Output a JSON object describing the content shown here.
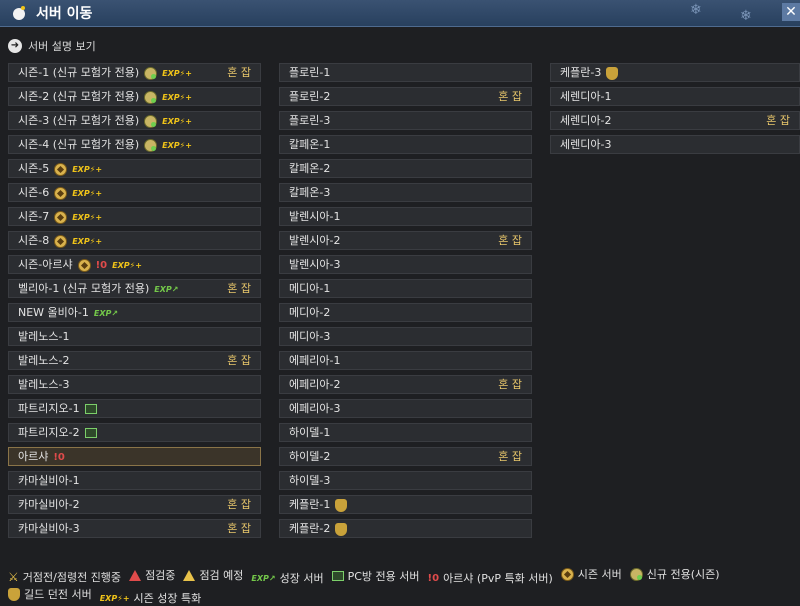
{
  "window": {
    "title": "서버 이동",
    "close_label": "✕"
  },
  "description_link": "서버 설명 보기",
  "columns": [
    [
      {
        "name": "시즌-1 (신규 모험가 전용)",
        "icons": [
          "newseason",
          "expup"
        ],
        "crowd": "혼 잡"
      },
      {
        "name": "시즌-2 (신규 모험가 전용)",
        "icons": [
          "newseason",
          "expup"
        ],
        "crowd": ""
      },
      {
        "name": "시즌-3 (신규 모험가 전용)",
        "icons": [
          "newseason",
          "expup"
        ],
        "crowd": ""
      },
      {
        "name": "시즌-4 (신규 모험가 전용)",
        "icons": [
          "newseason",
          "expup"
        ],
        "crowd": ""
      },
      {
        "name": "시즌-5",
        "icons": [
          "season",
          "expup"
        ],
        "crowd": ""
      },
      {
        "name": "시즌-6",
        "icons": [
          "season",
          "expup"
        ],
        "crowd": ""
      },
      {
        "name": "시즌-7",
        "icons": [
          "season",
          "expup"
        ],
        "crowd": ""
      },
      {
        "name": "시즌-8",
        "icons": [
          "season",
          "expup"
        ],
        "crowd": ""
      },
      {
        "name": "시즌-아르샤",
        "icons": [
          "season",
          "pvp",
          "expup"
        ],
        "crowd": ""
      },
      {
        "name": "벨리아-1 (신규 모험가 전용)",
        "icons": [
          "growth"
        ],
        "crowd": "혼 잡"
      },
      {
        "name": "NEW 올비아-1",
        "icons": [
          "growth"
        ],
        "crowd": ""
      },
      {
        "name": "발레노스-1",
        "icons": [],
        "crowd": ""
      },
      {
        "name": "발레노스-2",
        "icons": [],
        "crowd": "혼 잡"
      },
      {
        "name": "발레노스-3",
        "icons": [],
        "crowd": ""
      },
      {
        "name": "파트리지오-1",
        "icons": [
          "pc"
        ],
        "crowd": ""
      },
      {
        "name": "파트리지오-2",
        "icons": [
          "pc"
        ],
        "crowd": ""
      },
      {
        "name": "아르샤",
        "icons": [
          "pvp"
        ],
        "crowd": "",
        "selected": true
      },
      {
        "name": "카마실비아-1",
        "icons": [],
        "crowd": ""
      },
      {
        "name": "카마실비아-2",
        "icons": [],
        "crowd": "혼 잡"
      },
      {
        "name": "카마실비아-3",
        "icons": [],
        "crowd": "혼 잡"
      }
    ],
    [
      {
        "name": "플로린-1",
        "icons": [],
        "crowd": ""
      },
      {
        "name": "플로린-2",
        "icons": [],
        "crowd": "혼 잡"
      },
      {
        "name": "플로린-3",
        "icons": [],
        "crowd": ""
      },
      {
        "name": "칼페온-1",
        "icons": [],
        "crowd": ""
      },
      {
        "name": "칼페온-2",
        "icons": [],
        "crowd": ""
      },
      {
        "name": "칼페온-3",
        "icons": [],
        "crowd": ""
      },
      {
        "name": "발렌시아-1",
        "icons": [],
        "crowd": ""
      },
      {
        "name": "발렌시아-2",
        "icons": [],
        "crowd": "혼 잡"
      },
      {
        "name": "발렌시아-3",
        "icons": [],
        "crowd": ""
      },
      {
        "name": "메디아-1",
        "icons": [],
        "crowd": ""
      },
      {
        "name": "메디아-2",
        "icons": [],
        "crowd": ""
      },
      {
        "name": "메디아-3",
        "icons": [],
        "crowd": ""
      },
      {
        "name": "에페리아-1",
        "icons": [],
        "crowd": ""
      },
      {
        "name": "에페리아-2",
        "icons": [],
        "crowd": "혼 잡"
      },
      {
        "name": "에페리아-3",
        "icons": [],
        "crowd": ""
      },
      {
        "name": "하이델-1",
        "icons": [],
        "crowd": ""
      },
      {
        "name": "하이델-2",
        "icons": [],
        "crowd": "혼 잡"
      },
      {
        "name": "하이델-3",
        "icons": [],
        "crowd": ""
      },
      {
        "name": "케플란-1",
        "icons": [
          "guild"
        ],
        "crowd": ""
      },
      {
        "name": "케플란-2",
        "icons": [
          "guild"
        ],
        "crowd": ""
      }
    ],
    [
      {
        "name": "케플란-3",
        "icons": [
          "guild"
        ],
        "crowd": ""
      },
      {
        "name": "세렌디아-1",
        "icons": [],
        "crowd": ""
      },
      {
        "name": "세렌디아-2",
        "icons": [],
        "crowd": "혼 잡"
      },
      {
        "name": "세렌디아-3",
        "icons": [],
        "crowd": ""
      }
    ]
  ],
  "legend_line1": [
    {
      "icon": "swords",
      "label": "거점전/점령전 진행중"
    },
    {
      "icon": "maintenance",
      "label": "점검중"
    },
    {
      "icon": "scheduled",
      "label": "점검 예정"
    },
    {
      "icon": "growth",
      "label": "성장 서버"
    },
    {
      "icon": "pc",
      "label": "PC방 전용 서버"
    },
    {
      "icon": "pvp",
      "label": "아르샤 (PvP 특화 서버)"
    },
    {
      "icon": "season",
      "label": "시즌 서버"
    },
    {
      "icon": "newseason",
      "label": "신규 전용(시즌)"
    }
  ],
  "legend_line2": [
    {
      "icon": "guild",
      "label": "길드 던전 서버"
    },
    {
      "icon": "expup",
      "label": "시즌 성장 특화"
    }
  ],
  "icon_text": {
    "expup": "EXP⚡+",
    "growth": "EXP↗",
    "pvp": "!0",
    "swords": "⚔"
  }
}
